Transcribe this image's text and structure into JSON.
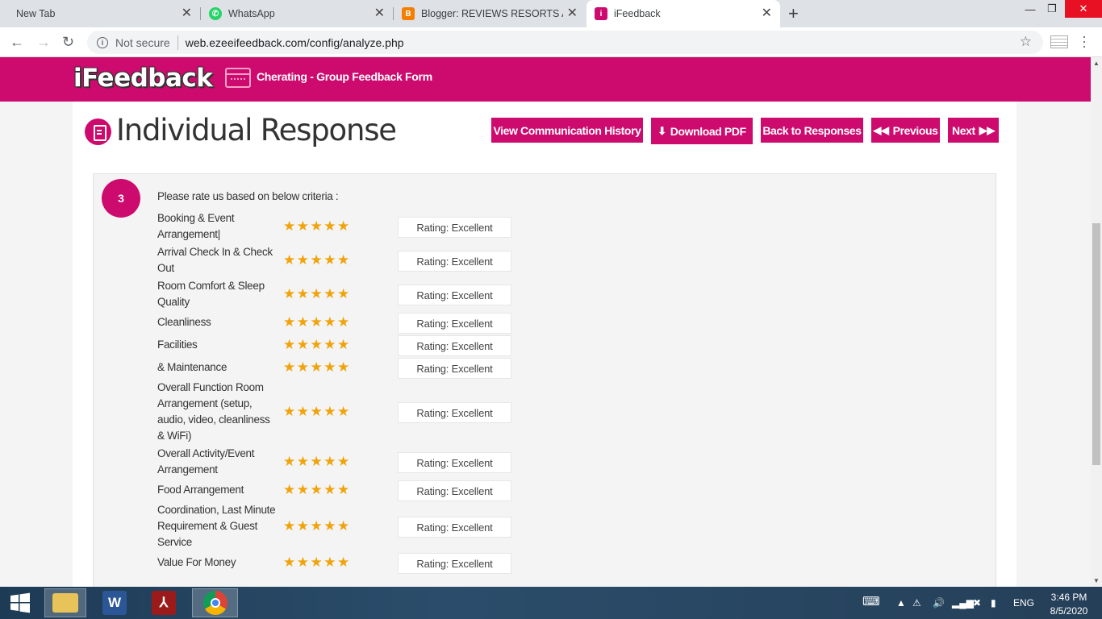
{
  "browser": {
    "tabs": [
      {
        "title": "New Tab",
        "active": false,
        "icon": "none"
      },
      {
        "title": "WhatsApp",
        "active": false,
        "icon": "whatsapp-icon"
      },
      {
        "title": "Blogger: REVIEWS RESORTS AND",
        "active": false,
        "icon": "blogger-icon"
      },
      {
        "title": "iFeedback",
        "active": true,
        "icon": "ifeedback-icon"
      }
    ],
    "security_label": "Not secure",
    "url": "web.ezeeifeedback.com/config/analyze.php"
  },
  "header": {
    "logo": "iFeedback",
    "form_name": "Cherating - Group Feedback Form",
    "brand_color": "#cd0a6e"
  },
  "page": {
    "title": "Individual Response",
    "buttons": {
      "history": "View Communication History",
      "pdf": "Download PDF",
      "back": "Back to Responses",
      "previous": "Previous",
      "next": "Next"
    }
  },
  "question": {
    "number": "3",
    "text": "Please rate us based on below criteria :",
    "rows": [
      {
        "label": "Booking & Event Arrangement|",
        "stars": "★★★★★",
        "rating": "Rating: Excellent"
      },
      {
        "label": "Arrival Check In & Check Out",
        "stars": "★★★★★",
        "rating": "Rating: Excellent"
      },
      {
        "label": "Room Comfort & Sleep Quality",
        "stars": "★★★★★",
        "rating": "Rating: Excellent"
      },
      {
        "label": "Cleanliness",
        "stars": "★★★★★",
        "rating": "Rating: Excellent"
      },
      {
        "label": "Facilities",
        "stars": "★★★★★",
        "rating": "Rating: Excellent"
      },
      {
        "label": "& Maintenance",
        "stars": "★★★★★",
        "rating": "Rating: Excellent"
      },
      {
        "label": "Overall Function Room Arrangement (setup, audio, video, cleanliness & WiFi)",
        "stars": "★★★★★",
        "rating": "Rating: Excellent"
      },
      {
        "label": "Overall Activity/Event Arrangement",
        "stars": "★★★★★",
        "rating": "Rating: Excellent"
      },
      {
        "label": "Food Arrangement",
        "stars": "★★★★★",
        "rating": "Rating: Excellent"
      },
      {
        "label": "Coordination, Last Minute Requirement & Guest Service",
        "stars": "★★★★★",
        "rating": "Rating: Excellent"
      },
      {
        "label": "Value For Money",
        "stars": "★★★★★",
        "rating": "Rating: Excellent"
      }
    ]
  },
  "taskbar": {
    "language": "ENG",
    "time": "3:46 PM",
    "date": "8/5/2020"
  }
}
